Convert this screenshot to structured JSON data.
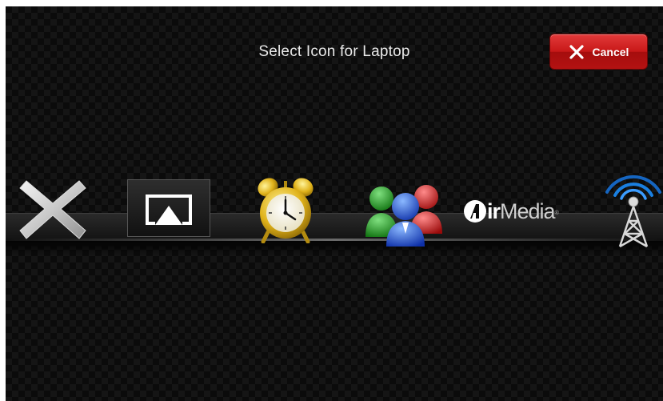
{
  "dialog": {
    "title": "Select Icon for Laptop",
    "cancel_label": "Cancel"
  },
  "icons": [
    {
      "name": "none",
      "icon": "x-icon"
    },
    {
      "name": "airplay",
      "icon": "airplay-icon"
    },
    {
      "name": "alarm-clock",
      "icon": "alarm-clock-icon"
    },
    {
      "name": "group",
      "icon": "people-group-icon"
    },
    {
      "name": "airmedia",
      "icon": "airmedia-logo",
      "logo_text": "AirMedia"
    },
    {
      "name": "broadcast-tower",
      "icon": "antenna-tower-icon"
    }
  ],
  "colors": {
    "background": "#0b0b0b",
    "cancel_button": "#c81818",
    "title_text": "#e8e8e8"
  }
}
